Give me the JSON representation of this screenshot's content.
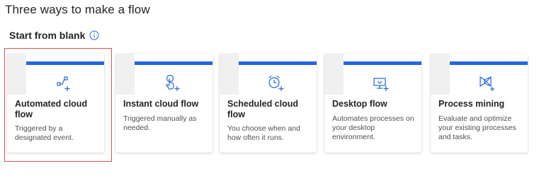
{
  "page": {
    "title": "Three ways to make a flow"
  },
  "section": {
    "title": "Start from blank",
    "info_icon": "info-icon"
  },
  "cards": [
    {
      "id": "automated-cloud-flow",
      "title": "Automated cloud flow",
      "description": "Triggered by a designated event.",
      "icon": "automated-flow-icon",
      "selected": true
    },
    {
      "id": "instant-cloud-flow",
      "title": "Instant cloud flow",
      "description": "Triggered manually as needed.",
      "icon": "instant-flow-icon",
      "selected": false
    },
    {
      "id": "scheduled-cloud-flow",
      "title": "Scheduled cloud flow",
      "description": "You choose when and how often it runs.",
      "icon": "scheduled-flow-icon",
      "selected": false
    },
    {
      "id": "desktop-flow",
      "title": "Desktop flow",
      "description": "Automates processes on your desktop environment.",
      "icon": "desktop-flow-icon",
      "selected": false
    },
    {
      "id": "process-mining",
      "title": "Process mining",
      "description": "Evaluate and optimize your existing processes and tasks.",
      "icon": "process-mining-icon",
      "selected": false
    }
  ],
  "colors": {
    "accent": "#2266e3",
    "selection_outline": "#d9534f",
    "icon_blue": "#2266e3"
  }
}
